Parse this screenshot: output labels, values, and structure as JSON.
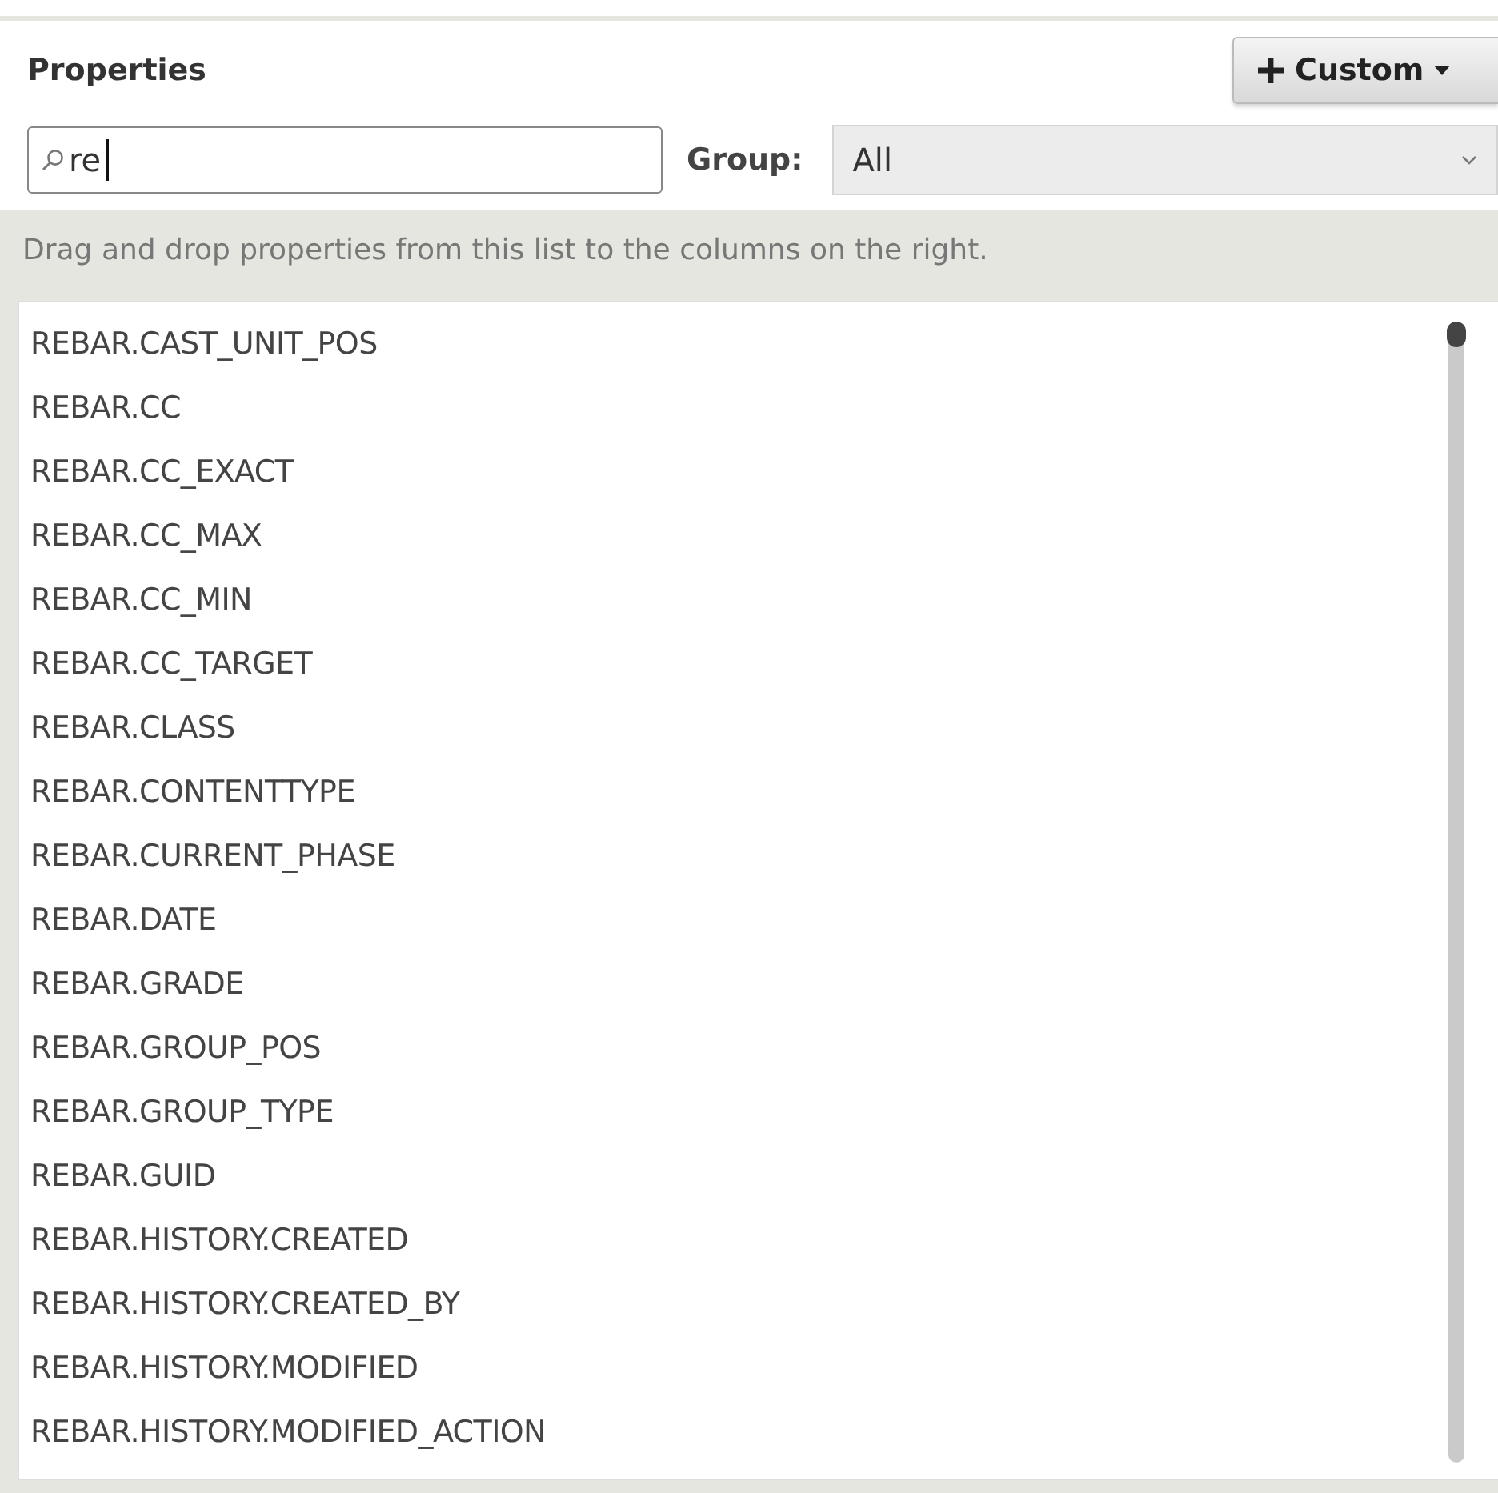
{
  "panel": {
    "title": "Properties"
  },
  "custom_button": {
    "label": "Custom"
  },
  "search": {
    "value": "re"
  },
  "group": {
    "label": "Group:",
    "value": "All"
  },
  "hint": "Drag and drop properties from this list to the columns on the right.",
  "properties": [
    {
      "label": "REBAR.CAST_UNIT_POS"
    },
    {
      "label": "REBAR.CC"
    },
    {
      "label": "REBAR.CC_EXACT"
    },
    {
      "label": "REBAR.CC_MAX"
    },
    {
      "label": "REBAR.CC_MIN"
    },
    {
      "label": "REBAR.CC_TARGET"
    },
    {
      "label": "REBAR.CLASS"
    },
    {
      "label": "REBAR.CONTENTTYPE"
    },
    {
      "label": "REBAR.CURRENT_PHASE"
    },
    {
      "label": "REBAR.DATE"
    },
    {
      "label": "REBAR.GRADE"
    },
    {
      "label": "REBAR.GROUP_POS"
    },
    {
      "label": "REBAR.GROUP_TYPE"
    },
    {
      "label": "REBAR.GUID"
    },
    {
      "label": "REBAR.HISTORY.CREATED"
    },
    {
      "label": "REBAR.HISTORY.CREATED_BY"
    },
    {
      "label": "REBAR.HISTORY.MODIFIED"
    },
    {
      "label": "REBAR.HISTORY.MODIFIED_ACTION"
    }
  ]
}
